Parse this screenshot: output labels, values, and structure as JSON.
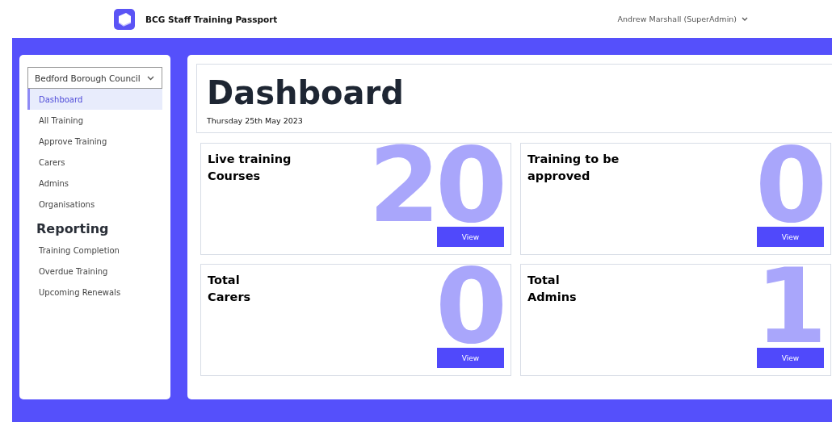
{
  "header": {
    "app_title": "BCG Staff Training Passport",
    "user": "Andrew Marshall (SuperAdmin)"
  },
  "sidebar": {
    "organisation": "Bedford Borough Council",
    "items": [
      {
        "label": "Dashboard",
        "selected": true
      },
      {
        "label": "All Training",
        "selected": false
      },
      {
        "label": "Approve Training",
        "selected": false
      },
      {
        "label": "Carers",
        "selected": false
      },
      {
        "label": "Admins",
        "selected": false
      },
      {
        "label": "Organisations",
        "selected": false
      }
    ],
    "reporting_heading": "Reporting",
    "reporting_items": [
      {
        "label": "Training Completion",
        "selected": false
      },
      {
        "label": "Overdue Training",
        "selected": false
      },
      {
        "label": "Upcoming Renewals",
        "selected": false
      }
    ]
  },
  "page": {
    "title": "Dashboard",
    "date": "Thursday 25th May 2023"
  },
  "cards": [
    {
      "title_lines": [
        "Live training",
        "Courses"
      ],
      "count": "20",
      "button": "View"
    },
    {
      "title_lines": [
        "Training to be",
        "approved"
      ],
      "count": "0",
      "button": "View"
    },
    {
      "title_lines": [
        "Total",
        "Carers"
      ],
      "count": "0",
      "button": "View"
    },
    {
      "title_lines": [
        "Total",
        "Admins"
      ],
      "count": "1",
      "button": "View"
    }
  ]
}
